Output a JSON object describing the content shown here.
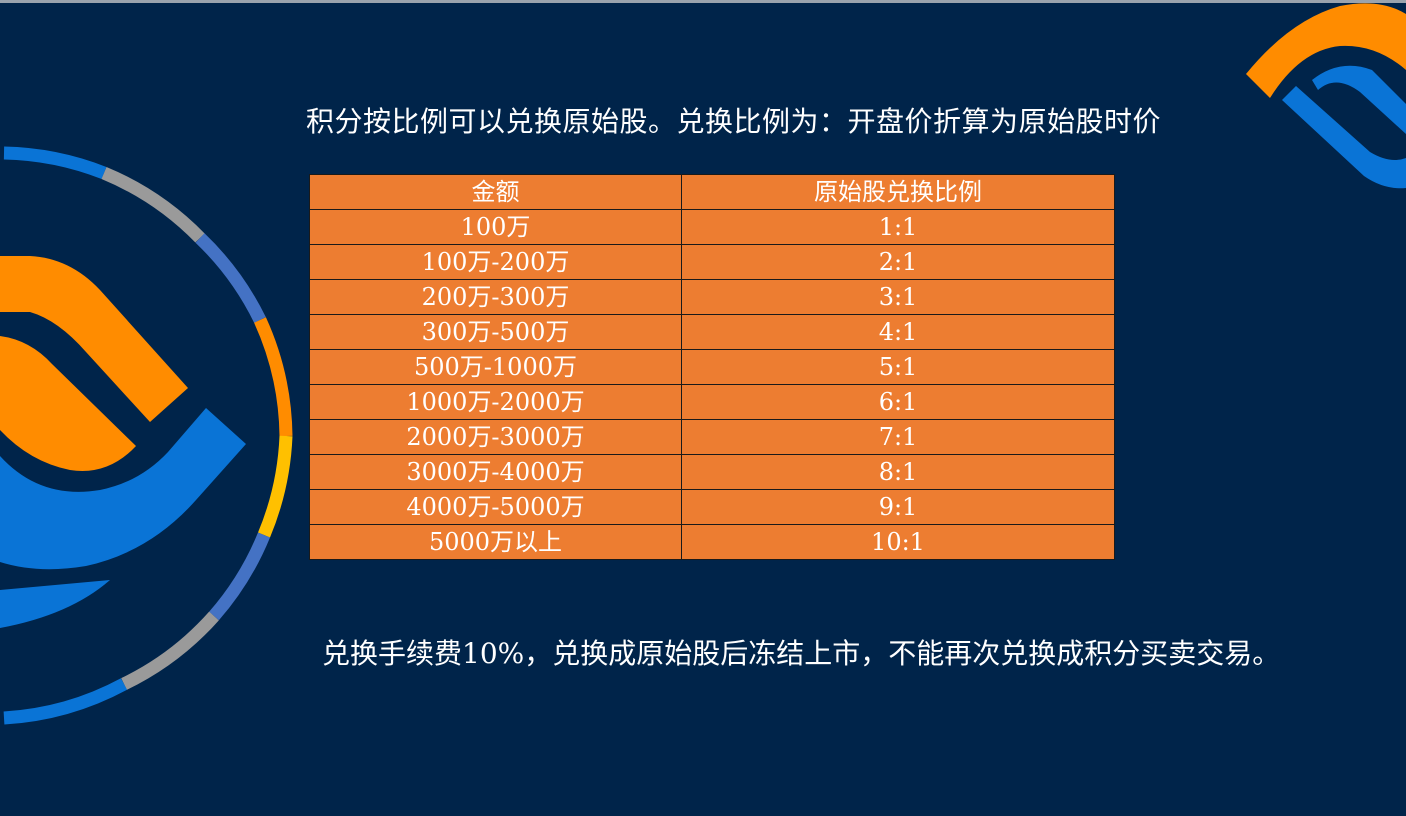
{
  "heading": "积分按比例可以兑换原始股。兑换比例为：开盘价折算为原始股时价",
  "table": {
    "headers": [
      "金额",
      "原始股兑换比例"
    ],
    "rows": [
      [
        "100万",
        "1:1"
      ],
      [
        "100万-200万",
        "2:1"
      ],
      [
        "200万-300万",
        "3:1"
      ],
      [
        "300万-500万",
        "4:1"
      ],
      [
        "500万-1000万",
        "5:1"
      ],
      [
        "1000万-2000万",
        "6:1"
      ],
      [
        "2000万-3000万",
        "7:1"
      ],
      [
        "3000万-4000万",
        "8:1"
      ],
      [
        "4000万-5000万",
        "9:1"
      ],
      [
        "5000万以上",
        "10:1"
      ]
    ]
  },
  "footer": "兑换手续费10%，兑换成原始股后冻结上市，不能再次兑换成积分买卖交易。",
  "colors": {
    "background": "#00244a",
    "table_fill": "#ed7d31",
    "accent_orange": "#ff8c00",
    "accent_blue": "#0a74d6",
    "ring_gray": "#9a9a9a",
    "ring_yellow": "#ffc000",
    "ring_slate": "#4472c4"
  }
}
